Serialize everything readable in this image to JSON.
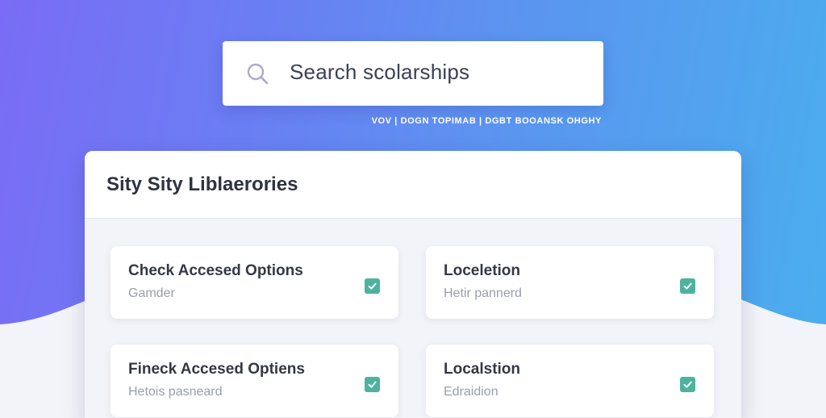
{
  "search": {
    "placeholder": "Search scolarships"
  },
  "subnav": {
    "text": "VOV  |  DOGN TOPIMAB  |  DGBT BOOANSK OHGHY"
  },
  "panel": {
    "title": "Sity Sity Liblaerories"
  },
  "cards": [
    {
      "title": "Check Accesed Options",
      "subtitle": "Gamder",
      "checked": true
    },
    {
      "title": "Loceletion",
      "subtitle": "Hetir pannerd",
      "checked": true
    },
    {
      "title": "Fineck Accesed Optiens",
      "subtitle": "Hetois pasneard",
      "checked": true
    },
    {
      "title": "Localstion",
      "subtitle": "Edraidion",
      "checked": true
    }
  ],
  "colors": {
    "gradient_start": "#7a6cf6",
    "gradient_end": "#4aaeee",
    "checkbox": "#4db39e"
  },
  "icons": {
    "search": "search-icon",
    "check": "check-icon"
  }
}
